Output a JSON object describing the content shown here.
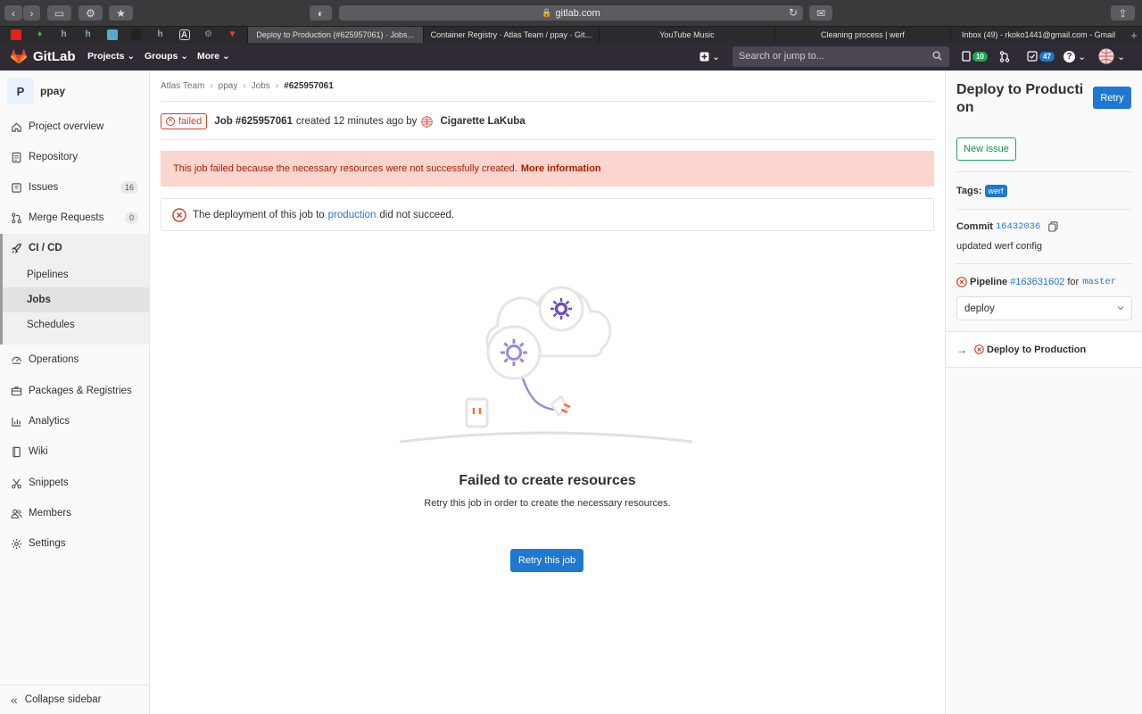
{
  "browser": {
    "url": "gitlab.com",
    "tabs": [
      {
        "title": "Deploy to Production (#625957061) · Jobs...",
        "active": true
      },
      {
        "title": "Container Registry · Atlas Team / ppay · Git...",
        "active": false
      },
      {
        "title": "YouTube Music",
        "active": false
      },
      {
        "title": "Cleaning process | werf",
        "active": false
      },
      {
        "title": "Inbox (49) - rkoko1441@gmail.com - Gmail",
        "active": false
      }
    ],
    "pinned_letters": [
      "h",
      "h",
      "h"
    ]
  },
  "topnav": {
    "brand": "GitLab",
    "projects": "Projects",
    "groups": "Groups",
    "more": "More",
    "search_placeholder": "Search or jump to...",
    "todo_count": "10",
    "issues_count": "47"
  },
  "sidebar": {
    "project_initial": "P",
    "project_name": "ppay",
    "items": [
      {
        "label": "Project overview",
        "icon": "home-icon"
      },
      {
        "label": "Repository",
        "icon": "doc-icon"
      },
      {
        "label": "Issues",
        "icon": "issues-icon",
        "count": "16"
      },
      {
        "label": "Merge Requests",
        "icon": "merge-request-icon",
        "count": "0"
      }
    ],
    "cicd": {
      "label": "CI / CD",
      "sub": [
        "Pipelines",
        "Jobs",
        "Schedules"
      ],
      "active": "Jobs"
    },
    "items2": [
      {
        "label": "Operations",
        "icon": "operations-icon"
      },
      {
        "label": "Packages & Registries",
        "icon": "package-icon"
      },
      {
        "label": "Analytics",
        "icon": "chart-icon"
      },
      {
        "label": "Wiki",
        "icon": "book-icon"
      },
      {
        "label": "Snippets",
        "icon": "scissors-icon"
      },
      {
        "label": "Members",
        "icon": "users-icon"
      },
      {
        "label": "Settings",
        "icon": "settings-icon"
      }
    ],
    "collapse": "Collapse sidebar"
  },
  "breadcrumb": [
    "Atlas Team",
    "ppay",
    "Jobs",
    "#625957061"
  ],
  "job": {
    "status": "failed",
    "title": "Job #625957061",
    "created": "created 12 minutes ago by",
    "author": "Cigarette LaKuba"
  },
  "alert": {
    "text": "This job failed because the necessary resources were not successfully created.",
    "link": "More information"
  },
  "deployment": {
    "prefix": "The deployment of this job to",
    "env": "production",
    "suffix": "did not succeed."
  },
  "empty_state": {
    "title": "Failed to create resources",
    "description": "Retry this job in order to create the necessary resources.",
    "button": "Retry this job"
  },
  "right_sidebar": {
    "title": "Deploy to Production",
    "retry": "Retry",
    "new_issue": "New issue",
    "tags_label": "Tags:",
    "tag": "werf",
    "commit_label": "Commit",
    "commit_sha": "16432036",
    "commit_msg": "updated werf config",
    "pipeline_label": "Pipeline",
    "pipeline_id": "#163631602",
    "pipeline_for": "for",
    "pipeline_ref": "master",
    "stage": "deploy",
    "job_name": "Deploy to Production"
  },
  "colors": {
    "primary": "#1f78d1",
    "danger": "#db3b21",
    "success": "#1aaa55",
    "nav": "#2f2a33"
  }
}
